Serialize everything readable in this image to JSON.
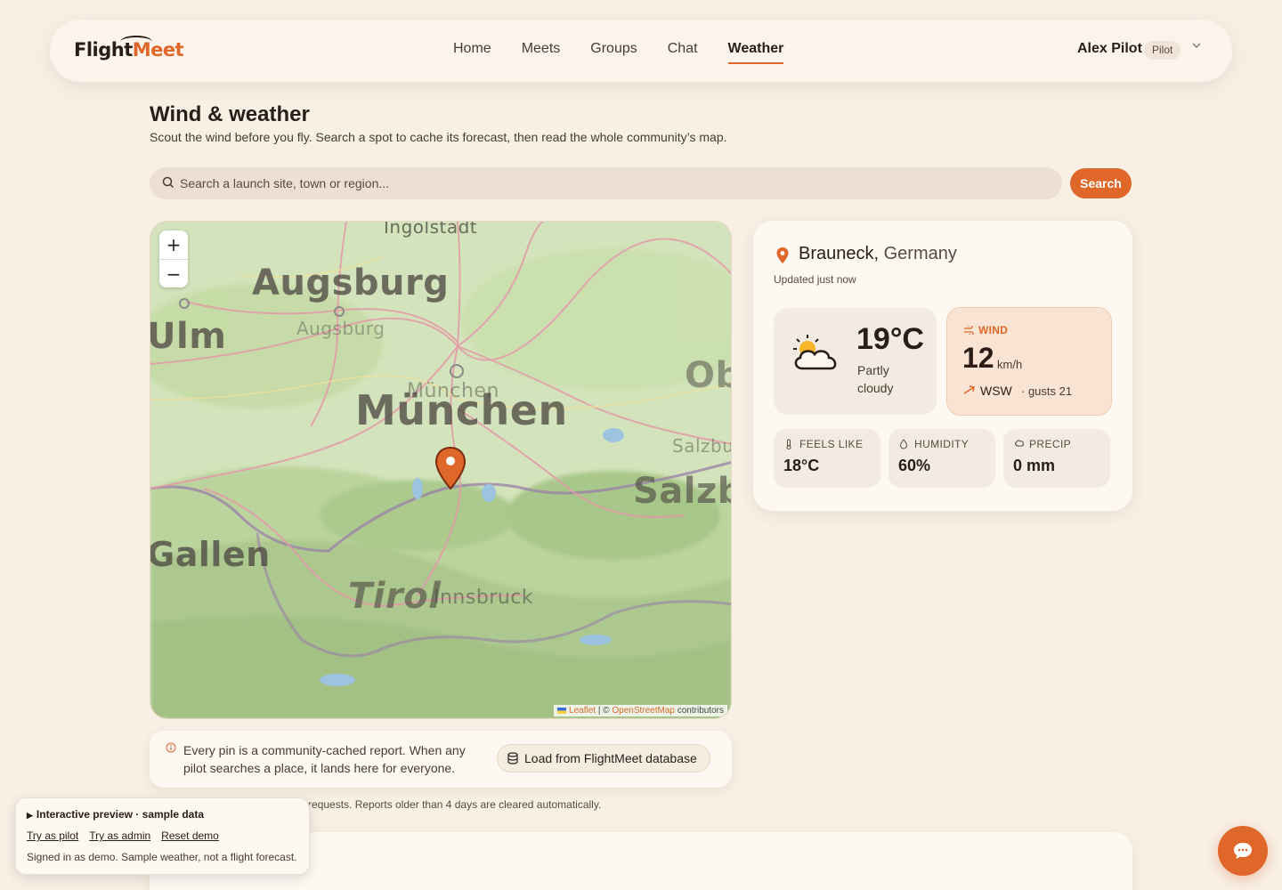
{
  "brand": {
    "part1": "Flight",
    "part2": "Meet"
  },
  "nav": {
    "items": [
      {
        "label": "Home",
        "active": false
      },
      {
        "label": "Meets",
        "active": false
      },
      {
        "label": "Groups",
        "active": false
      },
      {
        "label": "Chat",
        "active": false
      },
      {
        "label": "Weather",
        "active": true
      }
    ]
  },
  "user": {
    "name": "Alex Pilot",
    "role": "Pilot"
  },
  "page": {
    "title": "Wind & weather",
    "subtitle": "Scout the wind before you fly. Search a spot to cache its forecast, then read the whole community’s map."
  },
  "search": {
    "placeholder": "Search a launch site, town or region...",
    "value": "",
    "button": "Search"
  },
  "map": {
    "zoom_in": "+",
    "zoom_out": "−",
    "labels": {
      "ingolstadt": "Ingolstadt",
      "augsburg": "Augsburg",
      "augsburg_small": "Augsburg",
      "ulm": "Ulm",
      "munchen_small": "München",
      "munchen": "München",
      "salzburg": "Salzbu",
      "salzburg_big": "Salzb",
      "gallen": "Gallen",
      "tirol": "Tirol",
      "innsbruck": "Innsbruck",
      "ob": "Ob"
    },
    "attribution": {
      "leaflet": "Leaflet",
      "sep": " | © ",
      "osm": "OpenStreetMap",
      "suffix": " contributors"
    },
    "note": "Every pin is a community-cached report. When any pilot searches a place, it lands here for everyone.",
    "load_button": "Load from FlightMeet database",
    "footnote": "requests. Reports older than 4 days are cleared automatically."
  },
  "weather": {
    "city": "Brauneck",
    "country": "Germany",
    "updated": "Updated just now",
    "temp": "19°C",
    "condition": "Partly cloudy",
    "wind": {
      "label": "WIND",
      "speed": "12",
      "unit": "km/h",
      "direction": "WSW",
      "gusts": "· gusts 21"
    },
    "feels_like": {
      "label": "FEELS LIKE",
      "value": "18°C"
    },
    "humidity": {
      "label": "HUMIDITY",
      "value": "60%"
    },
    "precip": {
      "label": "PRECIP",
      "value": "0 mm"
    }
  },
  "preview": {
    "title": "Interactive preview · sample data",
    "links": [
      "Try as pilot",
      "Try as admin",
      "Reset demo"
    ],
    "note": "Signed in as demo. Sample weather, not a flight forecast."
  },
  "colors": {
    "accent": "#e0672a",
    "background": "#f8efe5",
    "card": "#fdf8f2"
  }
}
